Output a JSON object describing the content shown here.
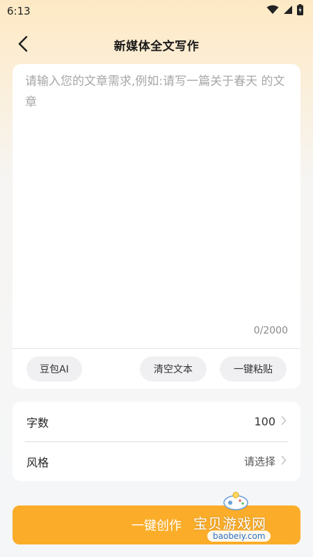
{
  "status_bar": {
    "time": "6:13"
  },
  "header": {
    "title": "新媒体全文写作"
  },
  "editor": {
    "placeholder": "请输入您的文章需求,例如:请写一篇关于春天 的文章",
    "value": "",
    "char_count": "0/2000"
  },
  "actions": {
    "doubao_label": "豆包AI",
    "clear_label": "清空文本",
    "paste_label": "一键粘贴"
  },
  "settings": {
    "word_count": {
      "label": "字数",
      "value": "100"
    },
    "style": {
      "label": "风格",
      "value": "请选择"
    }
  },
  "submit": {
    "label": "一键创作"
  },
  "watermark": {
    "text": "宝贝游戏网",
    "url": "baobeiy.com"
  },
  "colors": {
    "accent": "#fbad2a",
    "card": "#ffffff",
    "chip": "#f0f0f2",
    "header_gradient": "#fde9c4"
  },
  "icons": {
    "back": "chevron-left-icon",
    "wifi": "wifi-icon",
    "signal": "signal-icon",
    "battery": "battery-icon",
    "row_arrow": "chevron-right-icon"
  }
}
